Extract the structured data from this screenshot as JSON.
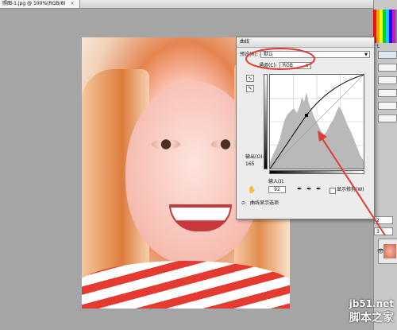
{
  "document": {
    "tab_title": "照图-1.jpg @ 100%(RGB/8)",
    "tab_close": "×"
  },
  "curves_dialog": {
    "title": "曲线",
    "preset_label": "预设(R):",
    "preset_value": "默认",
    "channel_label": "通道(C):",
    "channel_value": "RGB",
    "output_label": "输出(O):",
    "output_value": "165",
    "input_label": "输入(I):",
    "input_value": "92",
    "show_clipping_label": "显示修剪(W)",
    "curve_display_options_label": "曲线显示选项",
    "icons": [
      "curve-edit-icon",
      "pencil-icon",
      "hand-adjust-icon",
      "black-eyedropper-icon",
      "gray-eyedropper-icon",
      "white-eyedropper-icon",
      "expand-toggle-icon"
    ]
  },
  "right_panel": {
    "field1": "2",
    "field2": "3",
    "buttons": [
      "",
      "",
      "",
      "",
      "",
      ""
    ],
    "labels": [
      "L",
      "",
      "",
      "",
      "",
      ""
    ]
  },
  "watermark": {
    "line1": "jb51.net",
    "line2": "脚本之家"
  },
  "annotation_color": "#e53935"
}
